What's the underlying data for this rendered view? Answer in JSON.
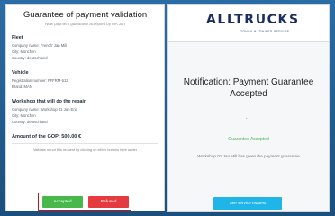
{
  "validation_form": {
    "title": "Guarantee of payment validation",
    "subtitle": "New payment guarantee accepted by MA Jan",
    "fleet": {
      "heading": "Fleet",
      "company_name": "Company name: French' Jan Mill",
      "city": "City: München",
      "country": "Country: deutschland"
    },
    "vehicle": {
      "heading": "Vehicle",
      "registration": "Registration number: FFFRM-513",
      "brand": "Brand: MAN"
    },
    "workshop": {
      "heading": "Workshop that will do the repair",
      "company_name": "Company name: Workshop 01 Jan Eric",
      "city": "City: München",
      "country": "Country: deutschland"
    },
    "amount": "Amount of the GOP: 500.00 €",
    "note": "Validate or not this request by clicking on either buttons here under",
    "accept_label": "Accepted",
    "refuse_label": "Refused"
  },
  "notification": {
    "logo": "ALLTRUCKS",
    "logo_tagline": "TRUCK & TRAILER SERVICE",
    "title": "Notification: Payment Guarantee Accepted",
    "dot": ".",
    "status": "Guarantee Accepted",
    "message": "Workshop 01 Jan Mill has given the payment guarantee",
    "cta_label": "See service request"
  },
  "colors": {
    "accept": "#49b84a",
    "refuse": "#e53a3f",
    "highlight_border": "#c9141b",
    "cta": "#1fb5e8",
    "status_green": "#4ab24e",
    "background": "#1f5d8f"
  }
}
